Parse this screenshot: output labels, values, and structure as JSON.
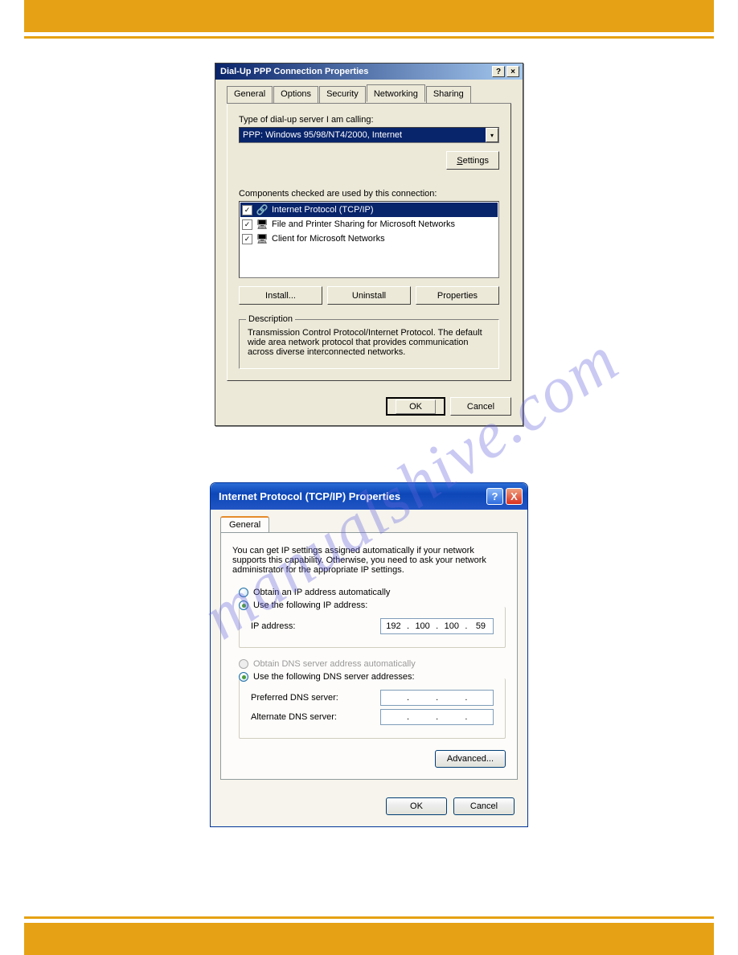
{
  "watermark": "manualshive.com",
  "dialog1": {
    "title": "Dial-Up PPP Connection Properties",
    "help_btn": "?",
    "close_btn": "×",
    "tabs": [
      "General",
      "Options",
      "Security",
      "Networking",
      "Sharing"
    ],
    "active_tab": 3,
    "server_label": "Type of dial-up server I am calling:",
    "server_value": "PPP: Windows 95/98/NT4/2000, Internet",
    "settings_btn": "Settings",
    "components_label": "Components checked are used by this connection:",
    "components": [
      {
        "checked": true,
        "icon": "net",
        "label": "Internet Protocol (TCP/IP)",
        "selected": true
      },
      {
        "checked": true,
        "icon": "share",
        "label": "File and Printer Sharing for Microsoft Networks",
        "selected": false
      },
      {
        "checked": true,
        "icon": "client",
        "label": "Client for Microsoft Networks",
        "selected": false
      }
    ],
    "install_btn": "Install...",
    "uninstall_btn": "Uninstall",
    "properties_btn": "Properties",
    "desc_title": "Description",
    "desc_text": "Transmission Control Protocol/Internet Protocol. The default wide area network protocol that provides communication across diverse interconnected networks.",
    "ok_btn": "OK",
    "cancel_btn": "Cancel"
  },
  "dialog2": {
    "title": "Internet Protocol (TCP/IP) Properties",
    "help_btn": "?",
    "close_btn": "X",
    "tab": "General",
    "intro": "You can get IP settings assigned automatically if your network supports this capability. Otherwise, you need to ask your network administrator for the appropriate IP settings.",
    "ip_auto": "Obtain an IP address automatically",
    "ip_manual": "Use the following IP address:",
    "ip_label": "IP address:",
    "ip_value": [
      "192",
      "100",
      "100",
      "59"
    ],
    "dns_auto": "Obtain DNS server address automatically",
    "dns_manual": "Use the following DNS server addresses:",
    "pref_dns": "Preferred DNS server:",
    "alt_dns": "Alternate DNS server:",
    "advanced_btn": "Advanced...",
    "ok_btn": "OK",
    "cancel_btn": "Cancel"
  }
}
